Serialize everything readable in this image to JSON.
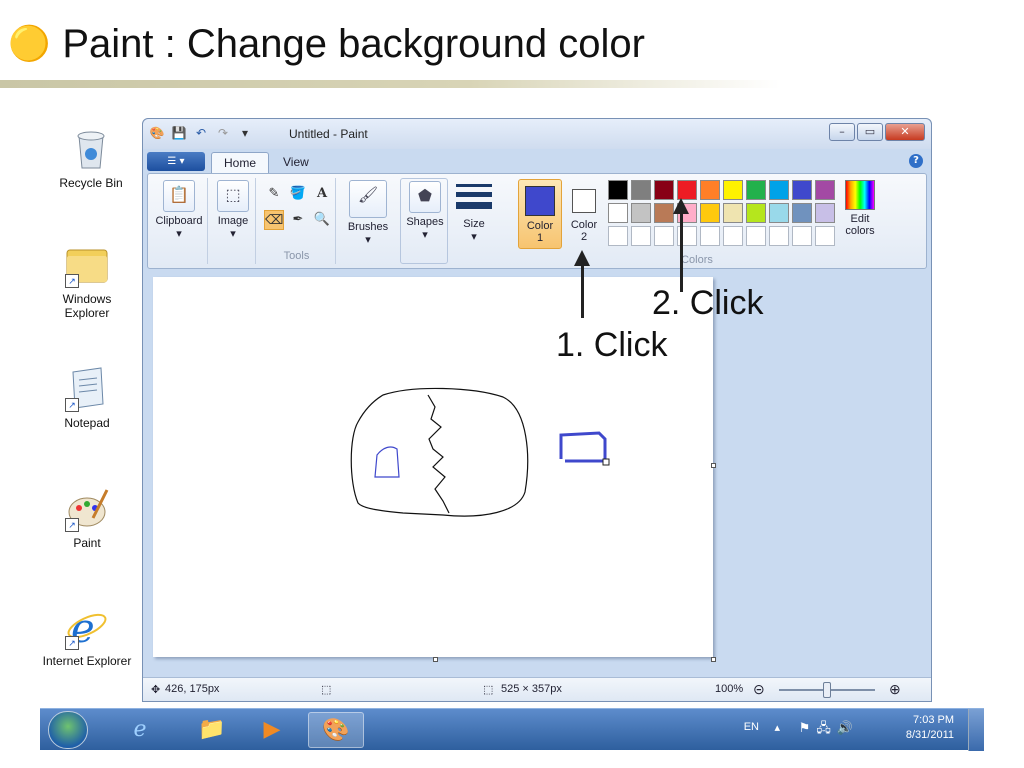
{
  "slide": {
    "title": "Paint : Change background color"
  },
  "desktop_icons": [
    {
      "label": "Recycle Bin"
    },
    {
      "label": "Windows Explorer"
    },
    {
      "label": "Notepad"
    },
    {
      "label": "Paint"
    },
    {
      "label": "Internet Explorer"
    }
  ],
  "window": {
    "title": "Untitled - Paint",
    "tabs": [
      {
        "label": "Home"
      },
      {
        "label": "View"
      }
    ],
    "active_tab": "Home",
    "groups": {
      "clipboard": "Clipboard",
      "image": "Image",
      "tools": "Tools",
      "brushes": "Brushes",
      "shapes": "Shapes",
      "size": "Size",
      "color1": "Color 1",
      "color2": "Color 2",
      "edit_colors": "Edit colors",
      "colors": "Colors"
    },
    "color1_value": "#3f48cc",
    "color2_value": "#ffffff",
    "palette": [
      "#000000",
      "#7f7f7f",
      "#880015",
      "#ed1c24",
      "#ff7f27",
      "#fff200",
      "#22b14c",
      "#00a2e8",
      "#3f48cc",
      "#a349a4",
      "#ffffff",
      "#c3c3c3",
      "#b97a57",
      "#ffaec9",
      "#ffc90e",
      "#efe4b0",
      "#b5e61d",
      "#99d9ea",
      "#7092be",
      "#c8bfe7",
      "#ffffff",
      "#ffffff",
      "#ffffff",
      "#ffffff",
      "#ffffff",
      "#ffffff",
      "#ffffff",
      "#ffffff",
      "#ffffff",
      "#ffffff"
    ]
  },
  "statusbar": {
    "cursor_pos": "426, 175px",
    "selection_size": "",
    "image_size": "525 × 357px",
    "zoom": "100%"
  },
  "taskbar": {
    "lang": "EN",
    "time": "7:03 PM",
    "date": "8/31/2011"
  },
  "annotations": {
    "step1": "1. Click",
    "step2": "2. Click"
  }
}
